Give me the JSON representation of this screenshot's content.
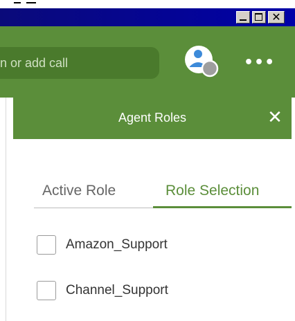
{
  "window": {
    "controls": {
      "minimize_icon": "minimize-icon",
      "maximize_icon": "maximize-icon",
      "close_icon": "close-icon"
    },
    "titlebar_color": "#0000a8"
  },
  "header": {
    "background_color": "#5b8e3a",
    "search": {
      "placeholder": "n or add call"
    },
    "avatar_icon": "user-avatar-icon",
    "more_icon": "more-options-icon",
    "more_glyph": "•••"
  },
  "panel": {
    "title": "Agent Roles",
    "close_glyph": "✕",
    "tabs": [
      {
        "label": "Active Role",
        "selected": false
      },
      {
        "label": "Role Selection",
        "selected": true
      }
    ],
    "roles": [
      {
        "label": "Amazon_Support",
        "checked": false
      },
      {
        "label": "Channel_Support",
        "checked": false
      }
    ],
    "accent_color": "#5b8e3a"
  },
  "win_close_glyph": "✕"
}
